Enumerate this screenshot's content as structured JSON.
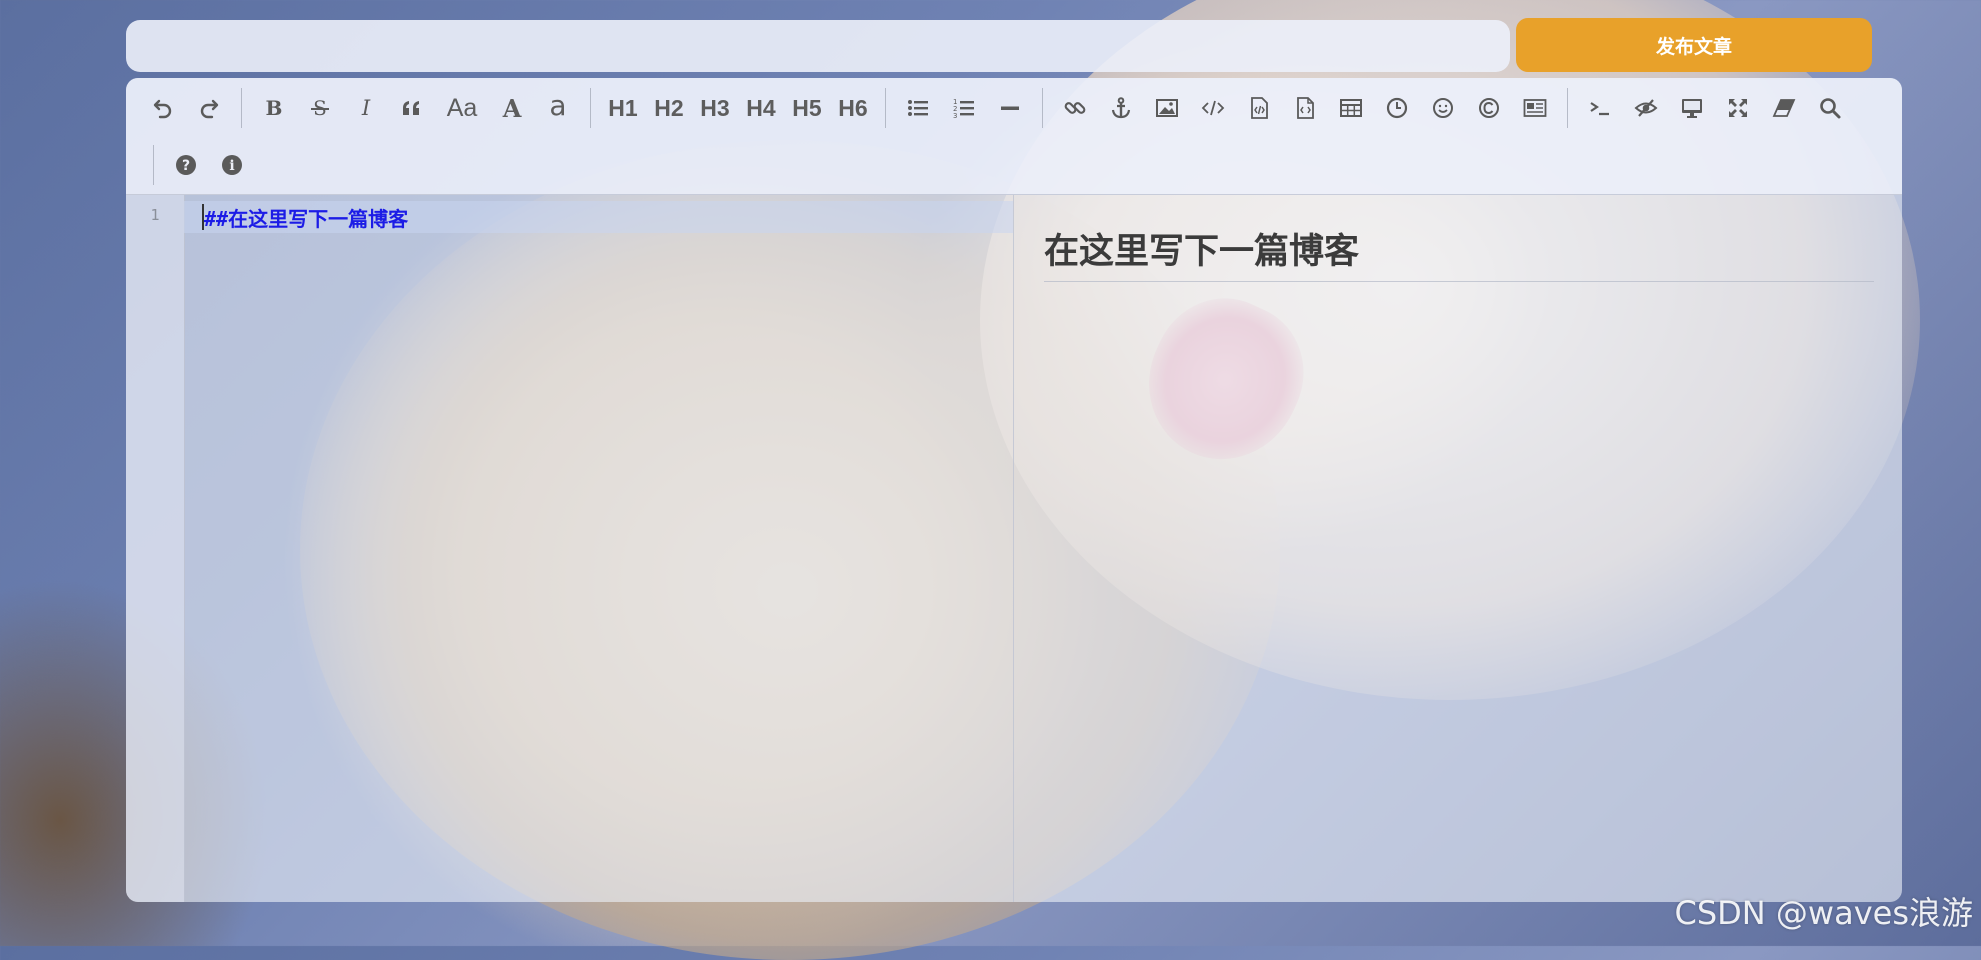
{
  "title_input": {
    "value": "",
    "placeholder": ""
  },
  "publish_button": {
    "label": "发布文章"
  },
  "toolbar": {
    "row1": [
      {
        "name": "undo-icon",
        "type": "icon"
      },
      {
        "name": "redo-icon",
        "type": "icon"
      },
      {
        "type": "sep"
      },
      {
        "name": "bold-icon",
        "type": "icon"
      },
      {
        "name": "strikethrough-icon",
        "type": "icon"
      },
      {
        "name": "italic-icon",
        "type": "icon"
      },
      {
        "name": "quote-icon",
        "type": "icon"
      },
      {
        "name": "uppercase-toggle",
        "type": "text",
        "label": "Aa"
      },
      {
        "name": "uppercase-icon",
        "type": "text",
        "label": "A"
      },
      {
        "name": "lowercase-icon",
        "type": "text",
        "label": "a"
      },
      {
        "type": "sep"
      },
      {
        "name": "heading-h1",
        "type": "text",
        "label": "H1"
      },
      {
        "name": "heading-h2",
        "type": "text",
        "label": "H2"
      },
      {
        "name": "heading-h3",
        "type": "text",
        "label": "H3"
      },
      {
        "name": "heading-h4",
        "type": "text",
        "label": "H4"
      },
      {
        "name": "heading-h5",
        "type": "text",
        "label": "H5"
      },
      {
        "name": "heading-h6",
        "type": "text",
        "label": "H6"
      },
      {
        "type": "sep"
      },
      {
        "name": "bullet-list-icon",
        "type": "icon"
      },
      {
        "name": "numbered-list-icon",
        "type": "icon"
      },
      {
        "name": "horizontal-rule-icon",
        "type": "icon"
      },
      {
        "type": "sep"
      },
      {
        "name": "link-icon",
        "type": "icon"
      },
      {
        "name": "anchor-icon",
        "type": "icon"
      },
      {
        "name": "image-icon",
        "type": "icon"
      },
      {
        "name": "code-icon",
        "type": "icon"
      },
      {
        "name": "preformatted-code-icon",
        "type": "icon"
      },
      {
        "name": "code-block-icon",
        "type": "icon"
      },
      {
        "name": "table-icon",
        "type": "icon"
      },
      {
        "name": "clock-icon",
        "type": "icon"
      },
      {
        "name": "emoji-icon",
        "type": "icon"
      },
      {
        "name": "html-entities-icon",
        "type": "icon"
      },
      {
        "name": "pagebreak-icon",
        "type": "icon"
      },
      {
        "type": "sep"
      },
      {
        "name": "goto-line-icon",
        "type": "icon"
      },
      {
        "name": "toggle-preview-icon",
        "type": "icon"
      },
      {
        "name": "watch-icon",
        "type": "icon"
      },
      {
        "name": "fullscreen-icon",
        "type": "icon"
      },
      {
        "name": "clear-icon",
        "type": "icon"
      },
      {
        "name": "search-icon",
        "type": "icon"
      }
    ],
    "row2": [
      {
        "name": "help-icon",
        "type": "icon"
      },
      {
        "name": "info-icon",
        "type": "icon"
      }
    ]
  },
  "editor": {
    "line_number": "1",
    "code_line": "##在这里写下一篇博客"
  },
  "preview": {
    "heading": "在这里写下一篇博客"
  },
  "watermark": "CSDN @waves浪游",
  "colors": {
    "publish_button": "#e8a12a",
    "code_text": "#1c1ce6",
    "icon": "#5a5a5a"
  }
}
